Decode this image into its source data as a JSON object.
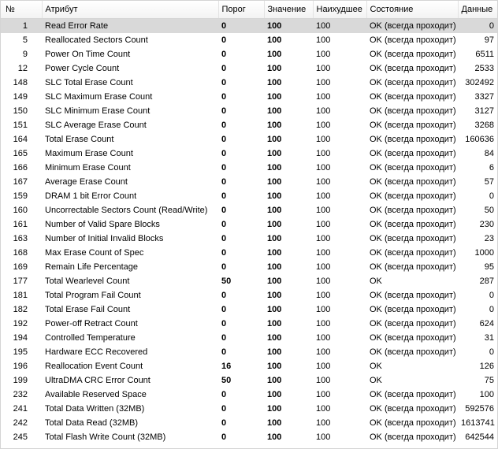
{
  "headers": {
    "num": "№",
    "attribute": "Атрибут",
    "threshold": "Порог",
    "value": "Значение",
    "worst": "Наихудшее",
    "status": "Состояние",
    "data": "Данные"
  },
  "selected_row_index": 0,
  "rows": [
    {
      "id": "1",
      "name": "Read Error Rate",
      "threshold": "0",
      "value": "100",
      "worst": "100",
      "status": "OK (всегда проходит)",
      "data": "0"
    },
    {
      "id": "5",
      "name": "Reallocated Sectors Count",
      "threshold": "0",
      "value": "100",
      "worst": "100",
      "status": "OK (всегда проходит)",
      "data": "97"
    },
    {
      "id": "9",
      "name": "Power On Time Count",
      "threshold": "0",
      "value": "100",
      "worst": "100",
      "status": "OK (всегда проходит)",
      "data": "6511"
    },
    {
      "id": "12",
      "name": "Power Cycle Count",
      "threshold": "0",
      "value": "100",
      "worst": "100",
      "status": "OK (всегда проходит)",
      "data": "2533"
    },
    {
      "id": "148",
      "name": "SLC Total Erase Count",
      "threshold": "0",
      "value": "100",
      "worst": "100",
      "status": "OK (всегда проходит)",
      "data": "302492"
    },
    {
      "id": "149",
      "name": "SLC Maximum Erase Count",
      "threshold": "0",
      "value": "100",
      "worst": "100",
      "status": "OK (всегда проходит)",
      "data": "3327"
    },
    {
      "id": "150",
      "name": "SLC Minimum Erase Count",
      "threshold": "0",
      "value": "100",
      "worst": "100",
      "status": "OK (всегда проходит)",
      "data": "3127"
    },
    {
      "id": "151",
      "name": "SLC Average Erase Count",
      "threshold": "0",
      "value": "100",
      "worst": "100",
      "status": "OK (всегда проходит)",
      "data": "3268"
    },
    {
      "id": "164",
      "name": "Total Erase Count",
      "threshold": "0",
      "value": "100",
      "worst": "100",
      "status": "OK (всегда проходит)",
      "data": "160636"
    },
    {
      "id": "165",
      "name": "Maximum Erase Count",
      "threshold": "0",
      "value": "100",
      "worst": "100",
      "status": "OK (всегда проходит)",
      "data": "84"
    },
    {
      "id": "166",
      "name": "Minimum Erase Count",
      "threshold": "0",
      "value": "100",
      "worst": "100",
      "status": "OK (всегда проходит)",
      "data": "6"
    },
    {
      "id": "167",
      "name": "Average Erase Count",
      "threshold": "0",
      "value": "100",
      "worst": "100",
      "status": "OK (всегда проходит)",
      "data": "57"
    },
    {
      "id": "159",
      "name": "DRAM 1 bit Error Count",
      "threshold": "0",
      "value": "100",
      "worst": "100",
      "status": "OK (всегда проходит)",
      "data": "0"
    },
    {
      "id": "160",
      "name": "Uncorrectable Sectors Count (Read/Write)",
      "threshold": "0",
      "value": "100",
      "worst": "100",
      "status": "OK (всегда проходит)",
      "data": "50"
    },
    {
      "id": "161",
      "name": "Number of Valid Spare Blocks",
      "threshold": "0",
      "value": "100",
      "worst": "100",
      "status": "OK (всегда проходит)",
      "data": "230"
    },
    {
      "id": "163",
      "name": "Number of Initial Invalid Blocks",
      "threshold": "0",
      "value": "100",
      "worst": "100",
      "status": "OK (всегда проходит)",
      "data": "23"
    },
    {
      "id": "168",
      "name": "Max Erase Count of Spec",
      "threshold": "0",
      "value": "100",
      "worst": "100",
      "status": "OK (всегда проходит)",
      "data": "1000"
    },
    {
      "id": "169",
      "name": "Remain Life Percentage",
      "threshold": "0",
      "value": "100",
      "worst": "100",
      "status": "OK (всегда проходит)",
      "data": "95"
    },
    {
      "id": "177",
      "name": "Total Wearlevel Count",
      "threshold": "50",
      "value": "100",
      "worst": "100",
      "status": "OK",
      "data": "287"
    },
    {
      "id": "181",
      "name": "Total Program Fail Count",
      "threshold": "0",
      "value": "100",
      "worst": "100",
      "status": "OK (всегда проходит)",
      "data": "0"
    },
    {
      "id": "182",
      "name": "Total Erase Fail Count",
      "threshold": "0",
      "value": "100",
      "worst": "100",
      "status": "OK (всегда проходит)",
      "data": "0"
    },
    {
      "id": "192",
      "name": "Power-off Retract Count",
      "threshold": "0",
      "value": "100",
      "worst": "100",
      "status": "OK (всегда проходит)",
      "data": "624"
    },
    {
      "id": "194",
      "name": "Controlled Temperature",
      "threshold": "0",
      "value": "100",
      "worst": "100",
      "status": "OK (всегда проходит)",
      "data": "31"
    },
    {
      "id": "195",
      "name": "Hardware ECC Recovered",
      "threshold": "0",
      "value": "100",
      "worst": "100",
      "status": "OK (всегда проходит)",
      "data": "0"
    },
    {
      "id": "196",
      "name": "Reallocation Event Count",
      "threshold": "16",
      "value": "100",
      "worst": "100",
      "status": "OK",
      "data": "126"
    },
    {
      "id": "199",
      "name": "UltraDMA CRC Error Count",
      "threshold": "50",
      "value": "100",
      "worst": "100",
      "status": "OK",
      "data": "75"
    },
    {
      "id": "232",
      "name": "Available Reserved Space",
      "threshold": "0",
      "value": "100",
      "worst": "100",
      "status": "OK (всегда проходит)",
      "data": "100"
    },
    {
      "id": "241",
      "name": "Total Data Written (32MB)",
      "threshold": "0",
      "value": "100",
      "worst": "100",
      "status": "OK (всегда проходит)",
      "data": "592576"
    },
    {
      "id": "242",
      "name": "Total Data Read (32MB)",
      "threshold": "0",
      "value": "100",
      "worst": "100",
      "status": "OK (всегда проходит)",
      "data": "1613741"
    },
    {
      "id": "245",
      "name": "Total Flash Write Count (32MB)",
      "threshold": "0",
      "value": "100",
      "worst": "100",
      "status": "OK (всегда проходит)",
      "data": "642544"
    }
  ]
}
